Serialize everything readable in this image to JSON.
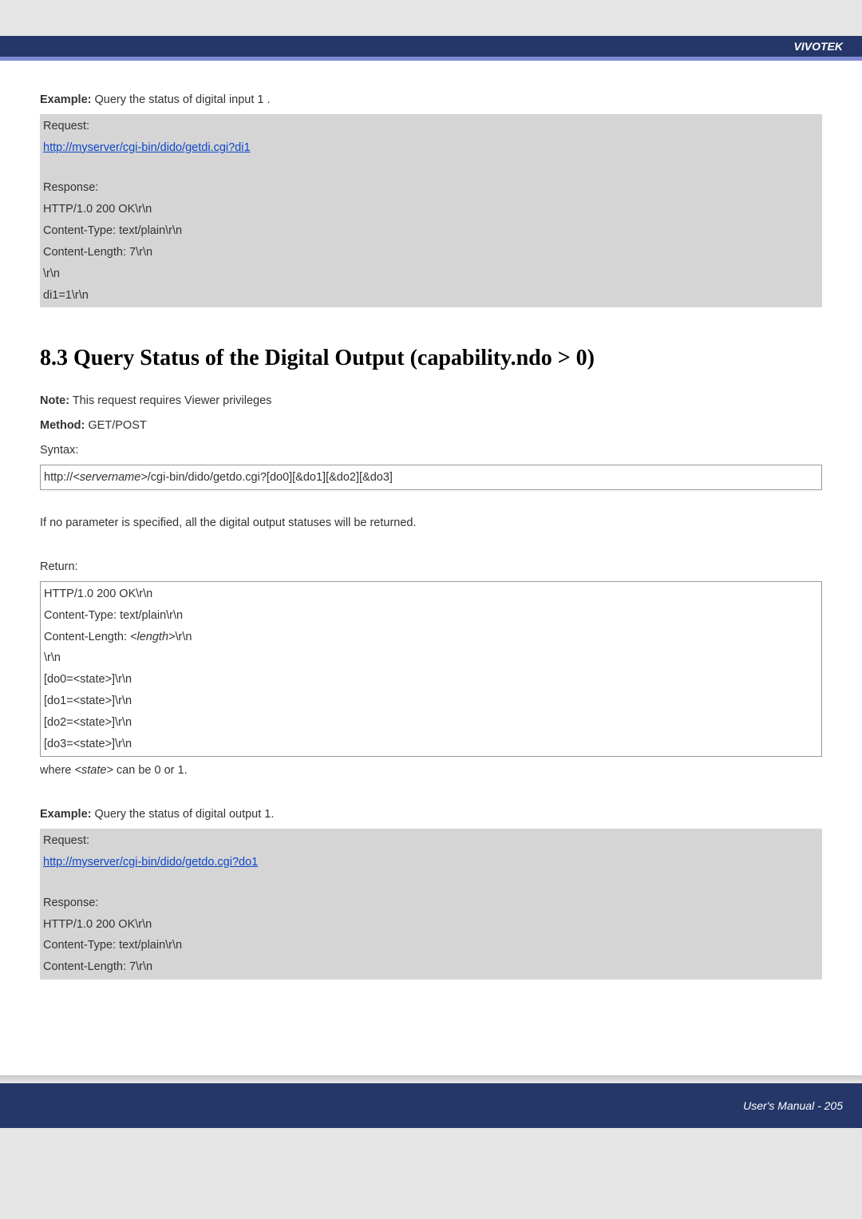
{
  "brand": "VIVOTEK",
  "example1": {
    "label": "Example:",
    "text": " Query the status of digital input 1 ."
  },
  "block1": {
    "request_label": "Request:",
    "request_url": "http://myserver/cgi-bin/dido/getdi.cgi?di1",
    "response_label": "Response:",
    "lines": [
      "HTTP/1.0 200 OK\\r\\n",
      "Content-Type: text/plain\\r\\n",
      "Content-Length: 7\\r\\n",
      "\\r\\n",
      "di1=1\\r\\n"
    ]
  },
  "section_title": "8.3 Query Status of the Digital Output (capability.ndo > 0)",
  "note": {
    "label": "Note:",
    "text": " This request requires Viewer privileges"
  },
  "method": {
    "label": "Method:",
    "text": " GET/POST"
  },
  "syntax_label": "Syntax:",
  "syntax_box": {
    "pre": "http://",
    "server": "<servername>",
    "post": "/cgi-bin/dido/getdo.cgi?[do0][&do1][&do2][&do3]"
  },
  "no_param_text": "If no parameter is specified, all the digital output statuses will be returned.",
  "return_label": "Return:",
  "return_box": {
    "l1": "HTTP/1.0 200 OK\\r\\n",
    "l2": "Content-Type: text/plain\\r\\n",
    "l3_pre": "Content-Length: ",
    "l3_len": "<length>",
    "l3_post": "\\r\\n",
    "l4": "\\r\\n",
    "l5": "[do0=<state>]\\r\\n",
    "l6": "[do1=<state>]\\r\\n",
    "l7": "[do2=<state>]\\r\\n",
    "l8": "[do3=<state>]\\r\\n"
  },
  "where": {
    "pre": "where ",
    "state": "<state>",
    "post": " can be 0 or 1."
  },
  "example2": {
    "label": "Example:",
    "text": " Query the status of digital output 1."
  },
  "block2": {
    "request_label": "Request:",
    "request_url": "http://myserver/cgi-bin/dido/getdo.cgi?do1",
    "response_label": "Response:",
    "lines": [
      "HTTP/1.0 200 OK\\r\\n",
      "Content-Type: text/plain\\r\\n",
      "Content-Length: 7\\r\\n"
    ]
  },
  "footer": "User's Manual - 205"
}
